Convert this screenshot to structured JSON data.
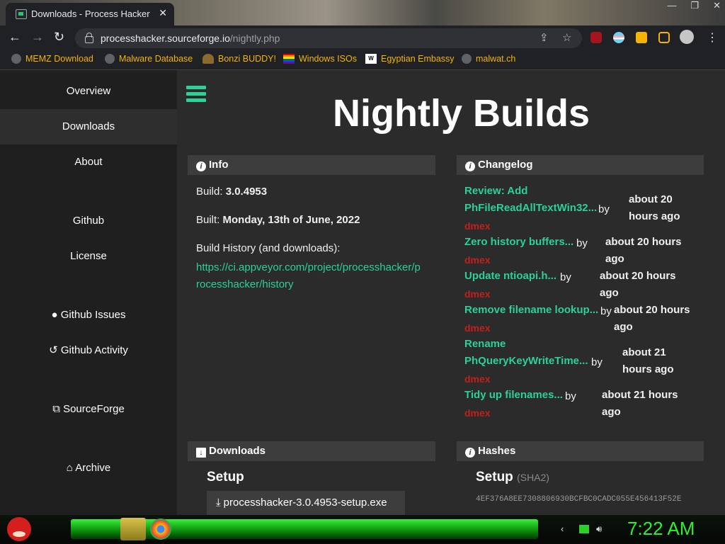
{
  "browser": {
    "tab_title": "Downloads - Process Hacker",
    "tab_close": "✕",
    "window_controls": [
      "—",
      "❐",
      "✕"
    ],
    "url_host": "processhacker.sourceforge.io",
    "url_path": "/nightly.php",
    "nav": {
      "back": "←",
      "forward": "→",
      "reload": "↻"
    },
    "omni_share": "⇪",
    "omni_star": "☆",
    "menu": "⋮",
    "bookmarks": [
      {
        "label": "MEMZ Download",
        "icon": "globe-icon"
      },
      {
        "label": "Malware Database",
        "icon": "globe-icon"
      },
      {
        "label": "Bonzi BUDDY!",
        "icon": "bonzi-icon"
      },
      {
        "label": "Windows ISOs",
        "icon": "rainbow-flag-icon"
      },
      {
        "label": "Egyptian Embassy",
        "icon": "wix-icon"
      },
      {
        "label": "malwat.ch",
        "icon": "globe-icon"
      }
    ]
  },
  "sidebar": {
    "items": [
      {
        "label": "Overview",
        "active": false
      },
      {
        "label": "Downloads",
        "active": true
      },
      {
        "label": "About",
        "active": false
      },
      {
        "label": "Github",
        "active": false
      },
      {
        "label": "License",
        "active": false
      },
      {
        "label": "Github Issues",
        "icon": "github-icon"
      },
      {
        "label": "Github Activity",
        "icon": "history-icon"
      },
      {
        "label": "SourceForge",
        "icon": "external-link-icon"
      },
      {
        "label": "Archive",
        "icon": "bank-icon"
      }
    ]
  },
  "page": {
    "title": "Nightly Builds",
    "info": {
      "header": "Info",
      "build_label": "Build: ",
      "build_value": "3.0.4953",
      "built_label": "Built: ",
      "built_value": "Monday, 13th of June, 2022",
      "history_label": "Build History (and downloads):",
      "history_link_1": "https://ci.appveyor.com/project/processhacker/p",
      "history_link_2": "rocesshacker/history"
    },
    "changelog": {
      "header": "Changelog",
      "by": "by",
      "author": "dmex",
      "entries": [
        {
          "title1": "Review: Add",
          "title2": "PhFileReadAllTextWin32...",
          "time1": "about 20",
          "time2": "hours ago"
        },
        {
          "title1": "Zero history buffers...",
          "time1": "about 20 hours",
          "time2": "ago"
        },
        {
          "title1": "Update ntioapi.h...",
          "time1": "about 20 hours",
          "time2": "ago"
        },
        {
          "title1": "Remove filename lookup...",
          "time1": "about 20 hours",
          "time2": "ago"
        },
        {
          "title1": "Rename",
          "title2": "PhQueryKeyWriteTime...",
          "time1": "about 21",
          "time2": "hours ago"
        },
        {
          "title1": "Tidy up filenames...",
          "time1": "about 21 hours",
          "time2": "ago"
        }
      ]
    },
    "downloads": {
      "header": "Downloads",
      "setup_title": "Setup",
      "setup_button": "processhacker-3.0.4953-setup.exe"
    },
    "hashes": {
      "header": "Hashes",
      "setup_title": "Setup",
      "setup_sub": "(SHA2)",
      "hash": "4EF376A8EE7308806930BCFBC0CADC055E456413F52E"
    }
  },
  "taskbar": {
    "clock": "7:22 AM"
  },
  "colors": {
    "accent": "#2bd197",
    "author": "#c21f1f",
    "clock": "#2bf02b"
  }
}
